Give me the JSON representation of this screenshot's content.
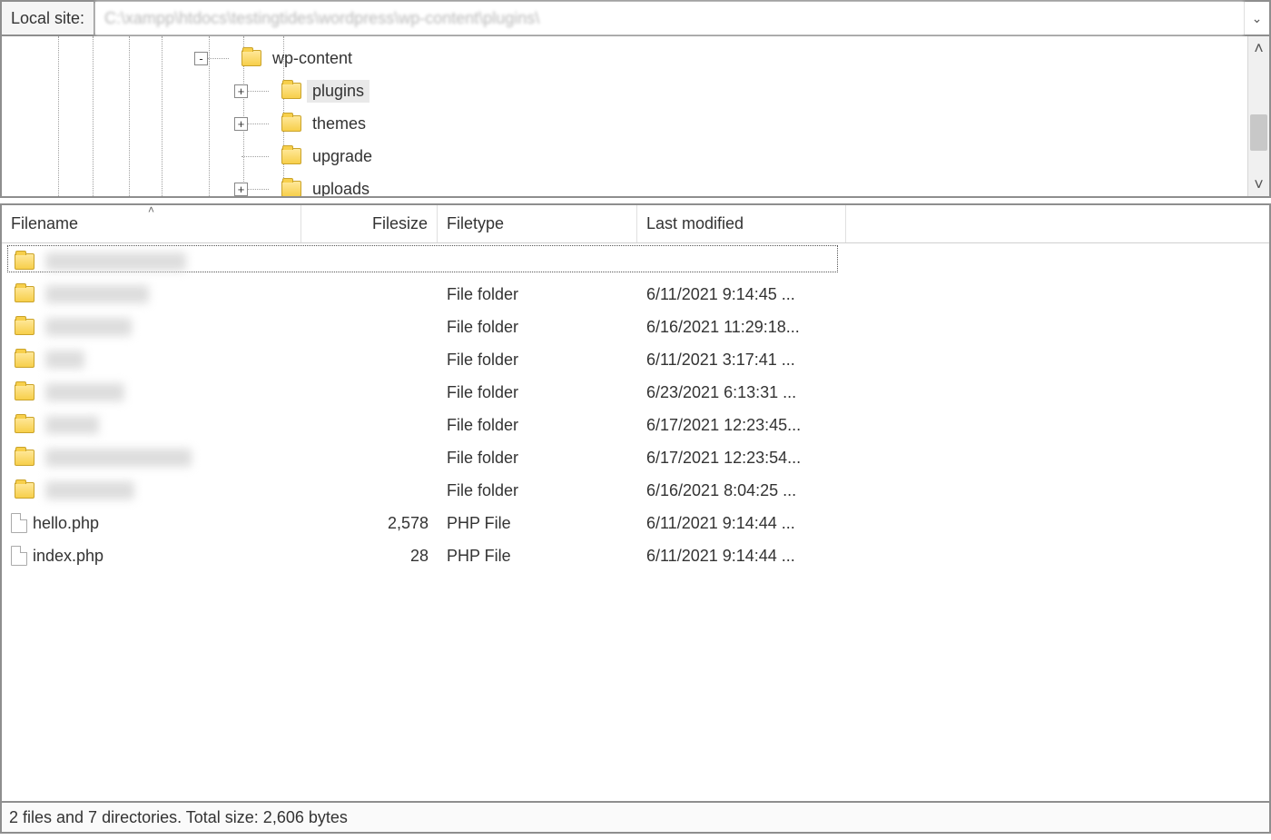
{
  "pathbar": {
    "label": "Local site:",
    "value": "C:\\xampp\\htdocs\\testingtides\\wordpress\\wp-content\\plugins\\",
    "drop_glyph": "⌄"
  },
  "tree": {
    "scroll_up_glyph": "˄",
    "scroll_down_glyph": "˅",
    "rows": [
      {
        "expander": "-",
        "label": "wp-content",
        "indent": 260,
        "selected": false
      },
      {
        "expander": "+",
        "label": "plugins",
        "indent": 304,
        "selected": true
      },
      {
        "expander": "+",
        "label": "themes",
        "indent": 304,
        "selected": false
      },
      {
        "expander": "",
        "label": "upgrade",
        "indent": 304,
        "selected": false
      },
      {
        "expander": "+",
        "label": "uploads",
        "indent": 304,
        "selected": false
      }
    ],
    "guide_lines_x": [
      62,
      100,
      140,
      176,
      228,
      266,
      310
    ]
  },
  "list": {
    "headers": {
      "name": "Filename",
      "size": "Filesize",
      "type": "Filetype",
      "modified": "Last modified"
    },
    "sort_caret": "˄",
    "rows": [
      {
        "icon": "folder",
        "name": "..",
        "blur": true,
        "size": "",
        "type": "",
        "modified": ""
      },
      {
        "icon": "folder",
        "name": "a",
        "blur": true,
        "size": "",
        "type": "File folder",
        "modified": "6/11/2021 9:14:45 ..."
      },
      {
        "icon": "folder",
        "name": "b",
        "blur": true,
        "size": "",
        "type": "File folder",
        "modified": "6/16/2021 11:29:18..."
      },
      {
        "icon": "folder",
        "name": "b",
        "blur": true,
        "size": "",
        "type": "File folder",
        "modified": "6/11/2021 3:17:41 ..."
      },
      {
        "icon": "folder",
        "name": "c",
        "blur": true,
        "size": "",
        "type": "File folder",
        "modified": "6/23/2021 6:13:31 ..."
      },
      {
        "icon": "folder",
        "name": "f",
        "blur": true,
        "size": "",
        "type": "File folder",
        "modified": "6/17/2021 12:23:45..."
      },
      {
        "icon": "folder",
        "name": "f",
        "blur": true,
        "size": "",
        "type": "File folder",
        "modified": "6/17/2021 12:23:54..."
      },
      {
        "icon": "folder",
        "name": "v",
        "blur": true,
        "size": "",
        "type": "File folder",
        "modified": "6/16/2021 8:04:25 ..."
      },
      {
        "icon": "file",
        "name": "hello.php",
        "blur": false,
        "size": "2,578",
        "type": "PHP File",
        "modified": "6/11/2021 9:14:44 ..."
      },
      {
        "icon": "file",
        "name": "index.php",
        "blur": false,
        "size": "28",
        "type": "PHP File",
        "modified": "6/11/2021 9:14:44 ..."
      }
    ]
  },
  "status": {
    "text": "2 files and 7 directories. Total size: 2,606 bytes"
  }
}
